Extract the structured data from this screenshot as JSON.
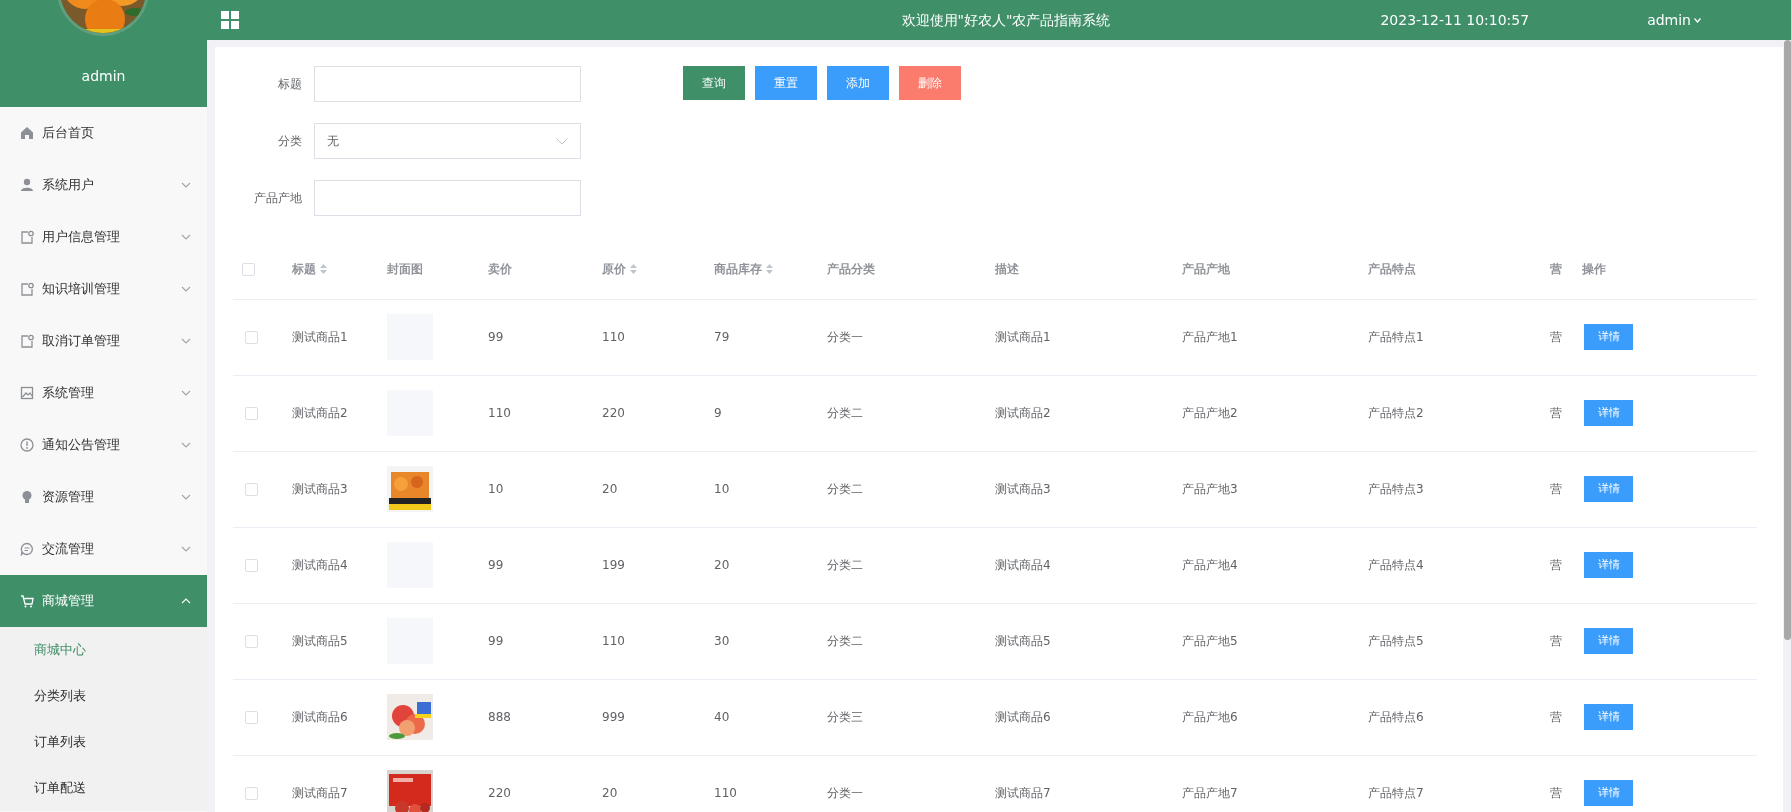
{
  "header": {
    "title": "欢迎使用\"好农人\"农产品指南系统",
    "datetime": "2023-12-11 10:10:57",
    "user": "admin"
  },
  "sidebar": {
    "avatar": {
      "kind": "picture"
    },
    "username": "admin",
    "items": [
      {
        "label": "后台首页",
        "selected": false
      },
      {
        "label": "系统用户",
        "expandable": true,
        "expanded": false,
        "selected": false
      },
      {
        "label": "用户信息管理",
        "expandable": true,
        "expanded": false,
        "selected": false
      },
      {
        "label": "知识培训管理",
        "expandable": true,
        "expanded": false,
        "selected": false
      },
      {
        "label": "取消订单管理",
        "expandable": true,
        "expanded": false,
        "selected": false
      },
      {
        "label": "系统管理",
        "expandable": true,
        "expanded": false,
        "selected": false
      },
      {
        "label": "通知公告管理",
        "expandable": true,
        "expanded": false,
        "selected": false
      },
      {
        "label": "资源管理",
        "expandable": true,
        "expanded": false,
        "selected": false
      },
      {
        "label": "交流管理",
        "expandable": true,
        "expanded": false,
        "selected": false
      },
      {
        "label": "商城管理",
        "expandable": true,
        "expanded": true,
        "selected": true,
        "children": [
          {
            "label": "商城中心",
            "selected": true
          },
          {
            "label": "分类列表",
            "selected": false
          },
          {
            "label": "订单列表",
            "selected": false
          },
          {
            "label": "订单配送",
            "selected": false
          }
        ]
      }
    ]
  },
  "filters": [
    {
      "label": "标题",
      "kind": "text"
    },
    {
      "label": "分类",
      "kind": "select",
      "value": "无"
    },
    {
      "label": "产品产地",
      "kind": "text"
    }
  ],
  "buttons": [
    {
      "label": "查询",
      "color": "#3f8f68"
    },
    {
      "label": "重置",
      "color": "#3a9cfb"
    },
    {
      "label": "添加",
      "color": "#3a9cfb"
    },
    {
      "label": "删除",
      "color": "#fb7b6c"
    }
  ],
  "table": {
    "select_all_checked": false,
    "columns": [
      {
        "label": "标题",
        "sortable": true
      },
      {
        "label": "封面图",
        "sortable": false
      },
      {
        "label": "卖价",
        "sortable": false
      },
      {
        "label": "原价",
        "sortable": true
      },
      {
        "label": "商品库存",
        "sortable": true
      },
      {
        "label": "产品分类",
        "sortable": false
      },
      {
        "label": "描述",
        "sortable": false
      },
      {
        "label": "产品产地",
        "sortable": false
      },
      {
        "label": "产品特点",
        "sortable": false
      },
      {
        "label": "营",
        "sortable": false
      },
      {
        "label": "操作",
        "sortable": false
      }
    ],
    "rows": [
      {
        "checked": false,
        "cells": [
          "测试商品1",
          "",
          "99",
          "110",
          "79",
          "分类一",
          "测试商品1",
          "产品产地1",
          "产品特点1",
          "营"
        ],
        "action": "详情"
      },
      {
        "checked": false,
        "cells": [
          "测试商品2",
          "",
          "110",
          "220",
          "9",
          "分类二",
          "测试商品2",
          "产品产地2",
          "产品特点2",
          "营"
        ],
        "action": "详情"
      },
      {
        "checked": false,
        "cover": {
          "kind": "picture"
        },
        "cells": [
          "测试商品3",
          "",
          "10",
          "20",
          "10",
          "分类二",
          "测试商品3",
          "产品产地3",
          "产品特点3",
          "营"
        ],
        "action": "详情"
      },
      {
        "checked": false,
        "cells": [
          "测试商品4",
          "",
          "99",
          "199",
          "20",
          "分类二",
          "测试商品4",
          "产品产地4",
          "产品特点4",
          "营"
        ],
        "action": "详情"
      },
      {
        "checked": false,
        "cells": [
          "测试商品5",
          "",
          "99",
          "110",
          "30",
          "分类二",
          "测试商品5",
          "产品产地5",
          "产品特点5",
          "营"
        ],
        "action": "详情"
      },
      {
        "checked": false,
        "cover": {
          "kind": "picture"
        },
        "cells": [
          "测试商品6",
          "",
          "888",
          "999",
          "40",
          "分类三",
          "测试商品6",
          "产品产地6",
          "产品特点6",
          "营"
        ],
        "action": "详情"
      },
      {
        "checked": false,
        "cover": {
          "kind": "picture"
        },
        "cells": [
          "测试商品7",
          "",
          "220",
          "20",
          "110",
          "分类一",
          "测试商品7",
          "产品产地7",
          "产品特点7",
          "营"
        ],
        "action": "详情"
      }
    ]
  }
}
